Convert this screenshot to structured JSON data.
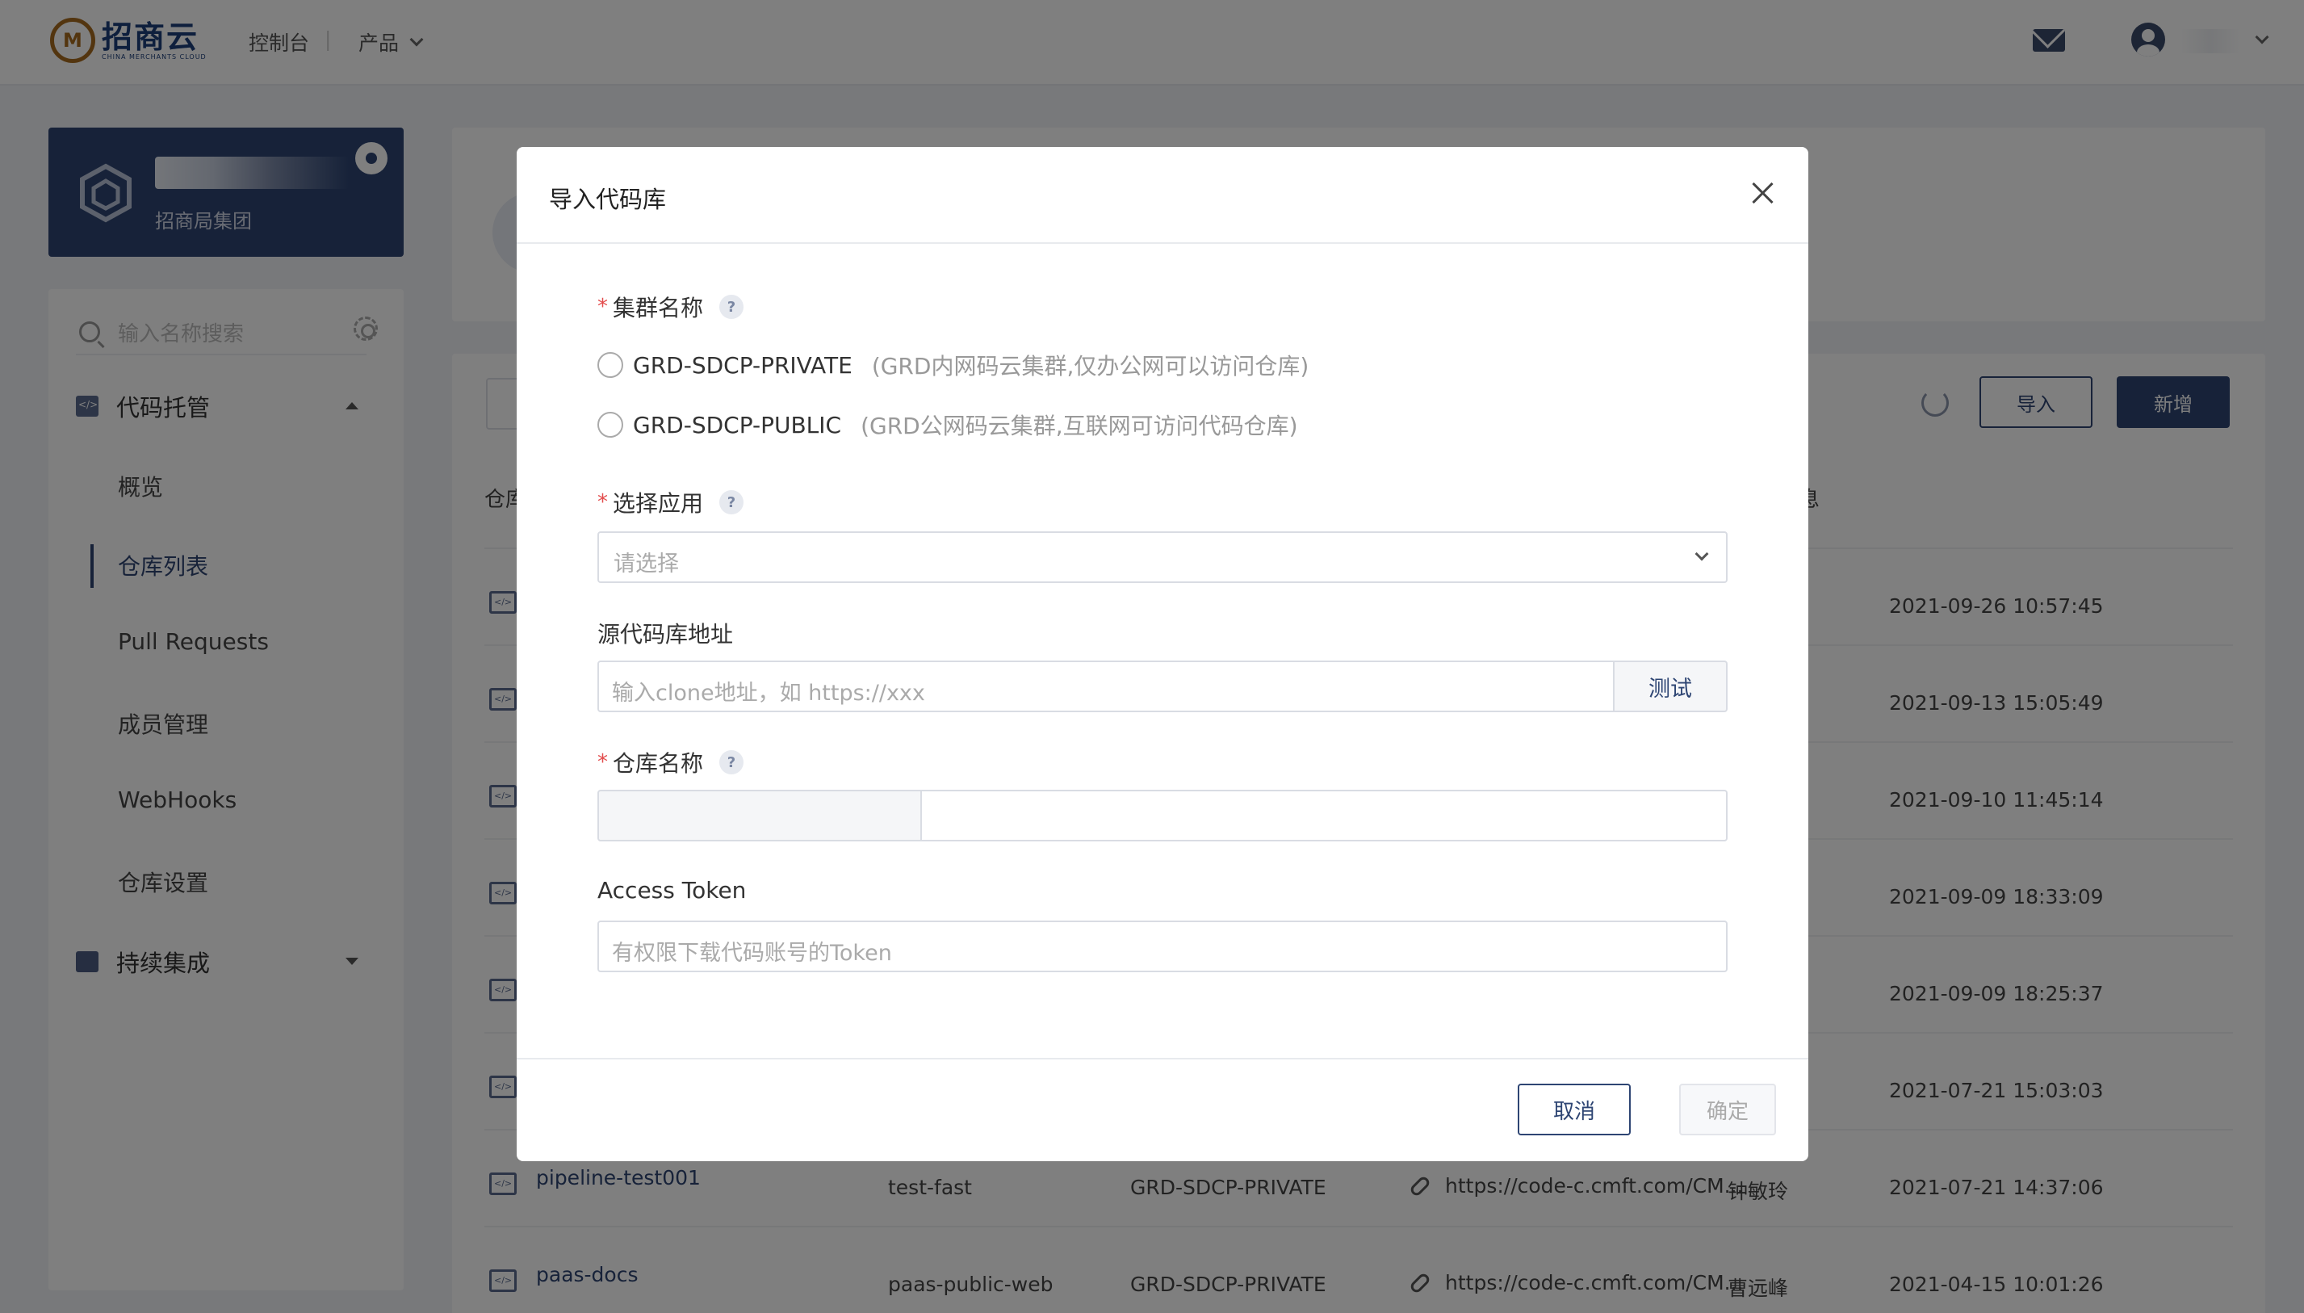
{
  "nav": {
    "logo_text": "招商云",
    "logo_sub": "CHINA MERCHANTS CLOUD",
    "console": "控制台",
    "separator": "|",
    "products": "产品"
  },
  "org": {
    "subtitle": "招商局集团"
  },
  "sidebar": {
    "search_placeholder": "输入名称搜索",
    "groups": [
      {
        "label": "代码托管",
        "icon": "code-repo-icon",
        "expanded": true
      },
      {
        "label": "持续集成",
        "icon": "ci-icon",
        "expanded": false
      }
    ],
    "items": [
      {
        "label": "概览"
      },
      {
        "label": "仓库列表",
        "active": true
      },
      {
        "label": "Pull Requests"
      },
      {
        "label": "成员管理"
      },
      {
        "label": "WebHooks"
      },
      {
        "label": "仓库设置"
      }
    ]
  },
  "list": {
    "import_label": "导入",
    "new_label": "新增",
    "header_left": "仓库",
    "header_right": "息",
    "rows": [
      {
        "name": "",
        "app": "",
        "cluster": "",
        "url": "",
        "owner": "",
        "time": "2021-09-26 10:57:45"
      },
      {
        "name": "",
        "app": "",
        "cluster": "",
        "url": "",
        "owner": "",
        "time": "2021-09-13 15:05:49"
      },
      {
        "name": "",
        "app": "",
        "cluster": "",
        "url": "",
        "owner": "",
        "time": "2021-09-10 11:45:14"
      },
      {
        "name": "",
        "app": "",
        "cluster": "",
        "url": "",
        "owner": "",
        "time": "2021-09-09 18:33:09"
      },
      {
        "name": "",
        "app": "",
        "cluster": "",
        "url": "",
        "owner": "",
        "time": "2021-09-09 18:25:37"
      },
      {
        "name": "",
        "app": "",
        "cluster": "",
        "url": "",
        "owner": "",
        "time": "2021-07-21 15:03:03"
      },
      {
        "name": "pipeline-test001",
        "app": "test-fast",
        "cluster": "GRD-SDCP-PRIVATE",
        "url": "https://code-c.cmft.com/CM...",
        "owner": "钟敏玲",
        "time": "2021-07-21 14:37:06"
      },
      {
        "name": "paas-docs",
        "app": "paas-public-web",
        "cluster": "GRD-SDCP-PRIVATE",
        "url": "https://code-c.cmft.com/CM...",
        "owner": "曹远峰",
        "time": "2021-04-15 10:01:26"
      }
    ]
  },
  "modal": {
    "title": "导入代码库",
    "cluster_label": "集群名称",
    "cluster_options": [
      {
        "value": "GRD-SDCP-PRIVATE",
        "note": "(GRD内网码云集群,仅办公网可以访问仓库)"
      },
      {
        "value": "GRD-SDCP-PUBLIC",
        "note": "(GRD公网码云集群,互联网可访问代码仓库)"
      }
    ],
    "app_label": "选择应用",
    "app_placeholder": "请选择",
    "source_label": "源代码库地址",
    "source_placeholder": "输入clone地址，如 https://xxx",
    "test_label": "测试",
    "repo_name_label": "仓库名称",
    "repo_name_prefix": "",
    "repo_name_value": "",
    "token_label": "Access Token",
    "token_placeholder": "有权限下载代码账号的Token",
    "cancel_label": "取消",
    "ok_label": "确定",
    "help_glyph": "?",
    "required_mark": "*"
  }
}
